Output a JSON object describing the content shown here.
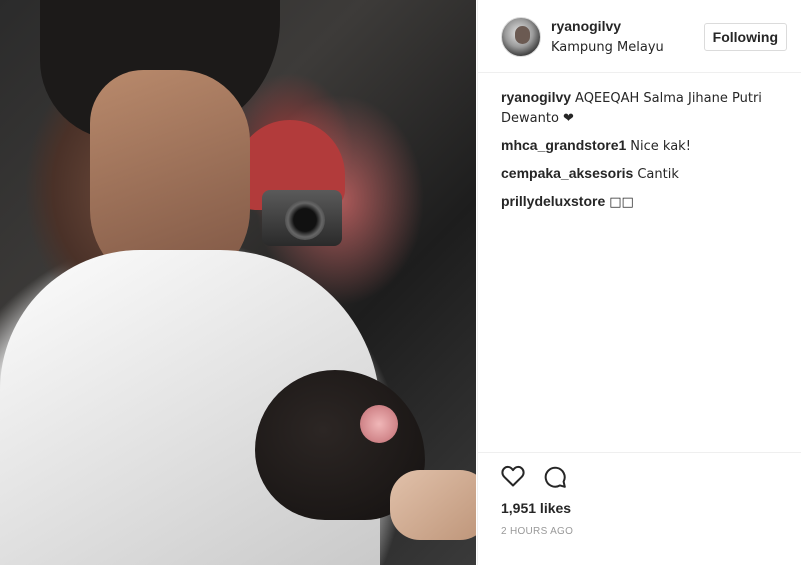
{
  "post": {
    "username": "ryanogilvy",
    "location": "Kampung Melayu",
    "follow_label": "Following",
    "caption": {
      "author": "ryanogilvy",
      "text": "AQEEQAH Salma Jihane Putri Dewanto ❤"
    },
    "comments": [
      {
        "author": "mhca_grandstore1",
        "text": "Nice kak!"
      },
      {
        "author": "cempaka_aksesoris",
        "text": "Cantik"
      },
      {
        "author": "prillydeluxstore",
        "text": "□□"
      }
    ],
    "likes": "1,951 likes",
    "time": "2 HOURS AGO"
  },
  "icons": {
    "like": "heart-icon",
    "comment": "comment-icon"
  },
  "colors": {
    "text": "#262626",
    "muted": "#999999",
    "border": "#dbdbdb"
  }
}
